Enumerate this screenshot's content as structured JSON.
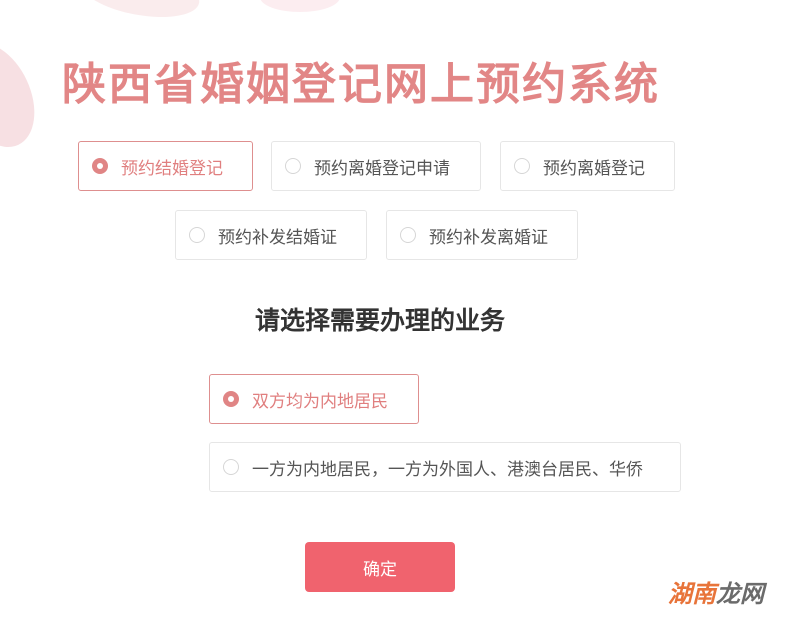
{
  "page": {
    "title": "陕西省婚姻登记网上预约系统",
    "business_options": [
      {
        "label": "预约结婚登记",
        "selected": true
      },
      {
        "label": "预约离婚登记申请",
        "selected": false
      },
      {
        "label": "预约离婚登记",
        "selected": false
      },
      {
        "label": "预约补发结婚证",
        "selected": false
      },
      {
        "label": "预约补发离婚证",
        "selected": false
      }
    ],
    "subtitle": "请选择需要办理的业务",
    "residency_options": [
      {
        "label": "双方均为内地居民",
        "selected": true
      },
      {
        "label": "一方为内地居民，一方为外国人、港澳台居民、华侨",
        "selected": false
      }
    ],
    "confirm_label": "确定"
  },
  "watermark": {
    "part1": "湖南",
    "part2": "龙网"
  },
  "colors": {
    "accent": "#e28686",
    "button": "#f0636e",
    "border": "#e6e6e6"
  }
}
